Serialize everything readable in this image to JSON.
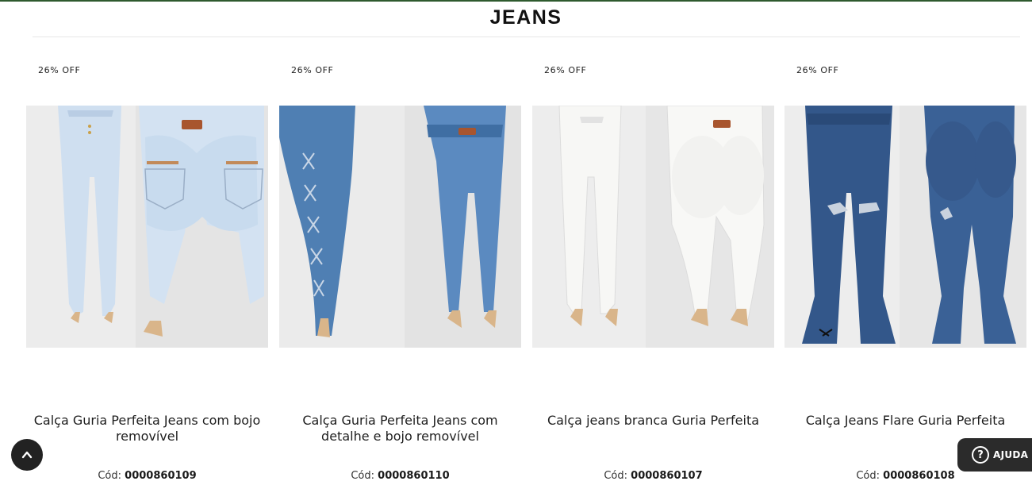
{
  "section": {
    "title": "JEANS"
  },
  "products": [
    {
      "badge": "26% OFF",
      "name": "Calça Guria Perfeita Jeans com bojo removível",
      "code_label": "Cód:",
      "code": "0000860109",
      "image": "light-wash-jeans-photo"
    },
    {
      "badge": "26% OFF",
      "name": "Calça Guria Perfeita Jeans com detalhe e bojo removível",
      "code_label": "Cód:",
      "code": "0000860110",
      "image": "medium-wash-laced-jeans-photo"
    },
    {
      "badge": "26% OFF",
      "name": "Calça jeans branca Guria Perfeita",
      "code_label": "Cód:",
      "code": "0000860107",
      "image": "white-jeans-photo"
    },
    {
      "badge": "26% OFF",
      "name": "Calça Jeans Flare Guria Perfeita",
      "code_label": "Cód:",
      "code": "0000860108",
      "image": "dark-flare-jeans-photo"
    }
  ],
  "help": {
    "label": "AJUDA",
    "icon": "question-icon"
  },
  "scroll_top": {
    "icon": "chevron-up-icon"
  },
  "colors": {
    "top_line": "#2e5a2e",
    "float_button": "#222222",
    "light_denim": "#cfdff0",
    "medium_denim": "#4f7fb3",
    "white_denim": "#f6f6f4",
    "dark_denim": "#33578a"
  }
}
